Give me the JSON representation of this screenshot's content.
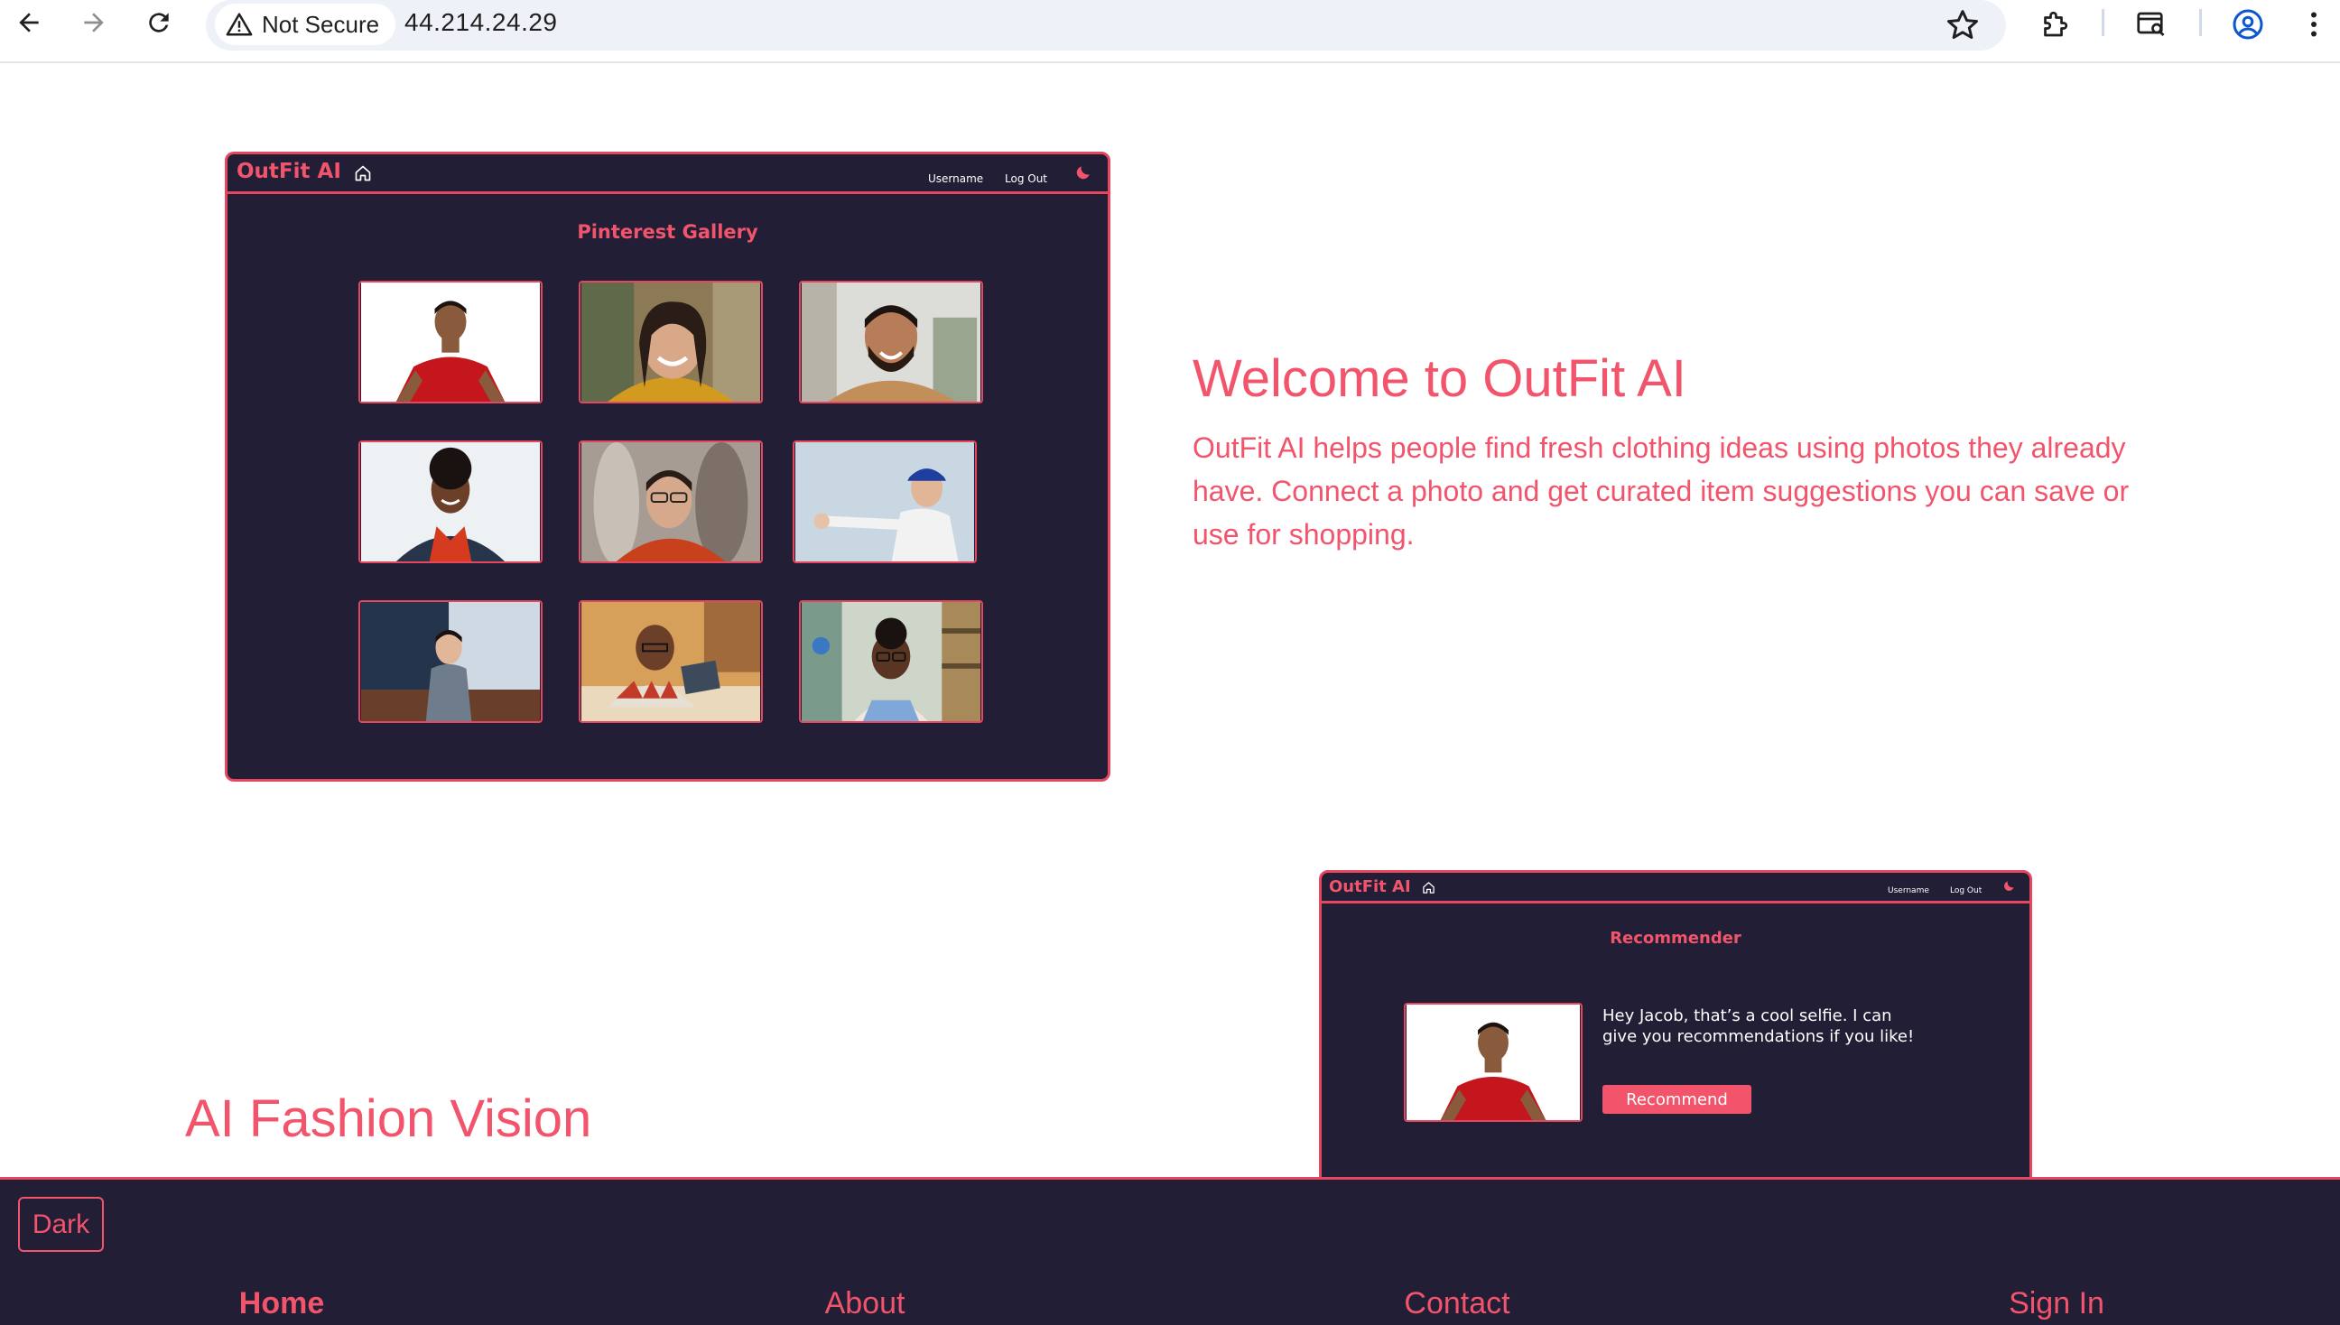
{
  "browser": {
    "security_label": "Not Secure",
    "url": "44.214.24.29"
  },
  "gallery_mock": {
    "logo": "OutFit AI",
    "username": "Username",
    "logout": "Log Out",
    "title": "Pinterest Gallery"
  },
  "hero": {
    "heading": "Welcome to OutFit AI",
    "text": "OutFit AI helps people find fresh clothing ideas using photos they already have. Connect a photo and get curated item suggestions you can save or use for shopping."
  },
  "recommender_mock": {
    "logo": "OutFit AI",
    "username": "Username",
    "logout": "Log Out",
    "title": "Recommender",
    "message": "Hey Jacob, that’s a cool selfie.  I can give you recommendations if you like!",
    "button": "Recommend"
  },
  "section2": {
    "heading": "AI Fashion Vision"
  },
  "footer": {
    "theme_button": "Dark",
    "links": [
      "Home",
      "About",
      "Contact",
      "Sign In"
    ]
  },
  "colors": {
    "accent": "#f2546c",
    "panel": "#221e36"
  }
}
